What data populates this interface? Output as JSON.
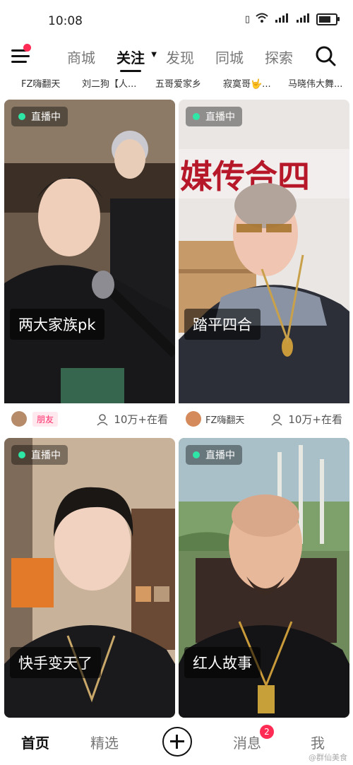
{
  "status_bar": {
    "time": "10:08",
    "signal_label": "4G",
    "signal_label2": "4G"
  },
  "top_nav": {
    "tabs": [
      {
        "label": "商城"
      },
      {
        "label": "关注"
      },
      {
        "label": "发现"
      },
      {
        "label": "同城"
      },
      {
        "label": "探索"
      }
    ],
    "active_index": 1
  },
  "follow_strip": [
    "FZ嗨翻天",
    "刘二狗【人...",
    "五哥爱家乡",
    "寂寞哥🤟...",
    "马晓伟大舞..."
  ],
  "live_badge_text": "直播中",
  "cards": [
    {
      "caption": "两大家族pk",
      "meta_tag": "朋友",
      "meta_name": "",
      "viewers": "10万+在看"
    },
    {
      "caption": "踏平四合",
      "meta_tag": "",
      "meta_name": "FZ嗨翻天",
      "viewers": "10万+在看"
    },
    {
      "caption": "快手变天了",
      "meta_tag": "",
      "meta_name": "",
      "viewers": ""
    },
    {
      "caption": "红人故事",
      "meta_tag": "",
      "meta_name": "",
      "viewers": ""
    }
  ],
  "bottom_nav": {
    "home": "首页",
    "featured": "精选",
    "messages": "消息",
    "messages_badge": "2",
    "me": "我",
    "watermark": "@群仙美食"
  },
  "colors": {
    "accent": "#ff2b54",
    "live_dot": "#2ee6a5"
  }
}
